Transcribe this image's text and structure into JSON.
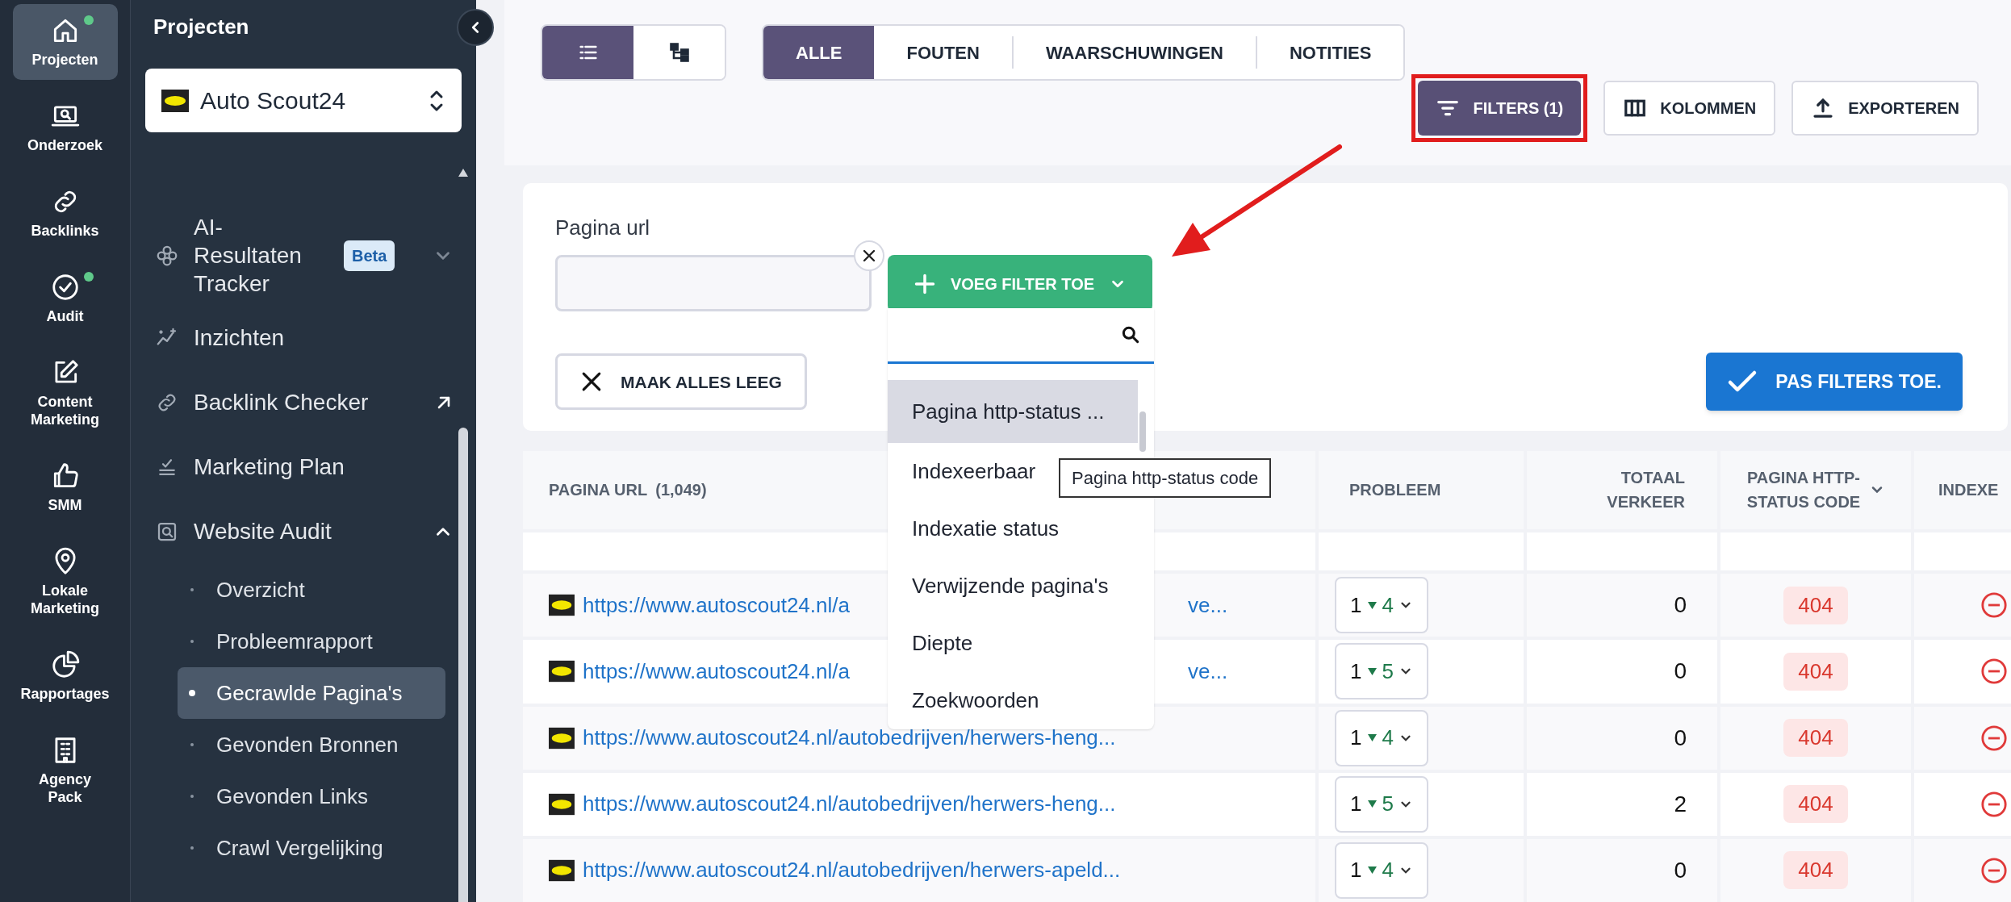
{
  "rail": [
    {
      "label": "Projecten",
      "kind": "home",
      "selected": true,
      "notification": true
    },
    {
      "label": "Onderzoek",
      "kind": "laptop",
      "selected": false,
      "notification": false
    },
    {
      "label": "Backlinks",
      "kind": "link",
      "selected": false,
      "notification": false
    },
    {
      "label": "Audit",
      "kind": "check",
      "selected": false,
      "notification": true
    },
    {
      "label": "Content Marketing",
      "kind": "edit",
      "selected": false,
      "notification": false
    },
    {
      "label": "SMM",
      "kind": "thumb",
      "selected": false,
      "notification": false
    },
    {
      "label": "Lokale Marketing",
      "kind": "pin",
      "selected": false,
      "notification": false
    },
    {
      "label": "Rapportages",
      "kind": "pie",
      "selected": false,
      "notification": false
    },
    {
      "label": "Agency Pack",
      "kind": "building",
      "selected": false,
      "notification": false
    }
  ],
  "sidebar": {
    "title": "Projecten",
    "project": "Auto Scout24",
    "items": [
      {
        "label": "AI-Resultaten Tracker",
        "kind": "ai",
        "badge": "Beta",
        "expanded": false
      },
      {
        "label": "Inzichten",
        "kind": "insights"
      },
      {
        "label": "Backlink Checker",
        "kind": "link",
        "external": true
      },
      {
        "label": "Marketing Plan",
        "kind": "plan"
      },
      {
        "label": "Website Audit",
        "kind": "audit",
        "expanded": true,
        "children": [
          {
            "label": "Overzicht",
            "selected": false
          },
          {
            "label": "Probleemrapport",
            "selected": false
          },
          {
            "label": "Gecrawlde Pagina's",
            "selected": true
          },
          {
            "label": "Gevonden Bronnen",
            "selected": false
          },
          {
            "label": "Gevonden Links",
            "selected": false
          },
          {
            "label": "Crawl Vergelijking",
            "selected": false
          }
        ]
      }
    ]
  },
  "view_toggle": [
    {
      "kind": "list",
      "selected": true
    },
    {
      "kind": "tree",
      "selected": false
    }
  ],
  "tabs": [
    {
      "label": "ALLE",
      "selected": true
    },
    {
      "label": "FOUTEN",
      "selected": false
    },
    {
      "label": "WAARSCHUWINGEN",
      "selected": false
    },
    {
      "label": "NOTITIES",
      "selected": false
    }
  ],
  "actions": [
    {
      "label": "FILTERS (1)",
      "kind": "filter",
      "active": true,
      "highlighted": true
    },
    {
      "label": "KOLOMMEN",
      "kind": "columns",
      "active": false,
      "highlighted": false
    },
    {
      "label": "EXPORTEREN",
      "kind": "export",
      "active": false,
      "highlighted": false
    }
  ],
  "filter_panel": {
    "field_label": "Pagina url",
    "add_button": "VOEG FILTER TOE",
    "clear_button": "MAAK ALLES LEEG",
    "apply_button": "PAS FILTERS TOE.",
    "dropdown": {
      "options": [
        {
          "label": "Pagina http-status ...",
          "selected": true
        },
        {
          "label": "Indexeerbaar",
          "selected": false
        },
        {
          "label": "Indexatie status",
          "selected": false
        },
        {
          "label": "Verwijzende pagina's",
          "selected": false
        },
        {
          "label": "Diepte",
          "selected": false
        },
        {
          "label": "Zoekwoorden",
          "selected": false
        }
      ]
    },
    "tooltip": "Pagina http-status code"
  },
  "table": {
    "columns": [
      {
        "label": "PAGINA URL",
        "count": "(1,049)"
      },
      {
        "label": "PROBLEEM"
      },
      {
        "label": "TOTAAL VERKEER"
      },
      {
        "label": "PAGINA HTTP-STATUS CODE",
        "sortable": true
      },
      {
        "label": "INDEXE"
      }
    ],
    "rows": [
      {
        "url": "https://www.autoscout24.nl/a",
        "url_tail": "ve...",
        "errors": "1",
        "warnings": "4",
        "traffic": "0",
        "status": "404"
      },
      {
        "url": "https://www.autoscout24.nl/a",
        "url_tail": "ve...",
        "errors": "1",
        "warnings": "5",
        "traffic": "0",
        "status": "404"
      },
      {
        "url": "https://www.autoscout24.nl/autobedrijven/herwers-heng...",
        "errors": "1",
        "warnings": "4",
        "traffic": "0",
        "status": "404"
      },
      {
        "url": "https://www.autoscout24.nl/autobedrijven/herwers-heng...",
        "errors": "1",
        "warnings": "5",
        "traffic": "2",
        "status": "404"
      },
      {
        "url": "https://www.autoscout24.nl/autobedrijven/herwers-apeld...",
        "errors": "1",
        "warnings": "4",
        "traffic": "0",
        "status": "404"
      }
    ]
  }
}
